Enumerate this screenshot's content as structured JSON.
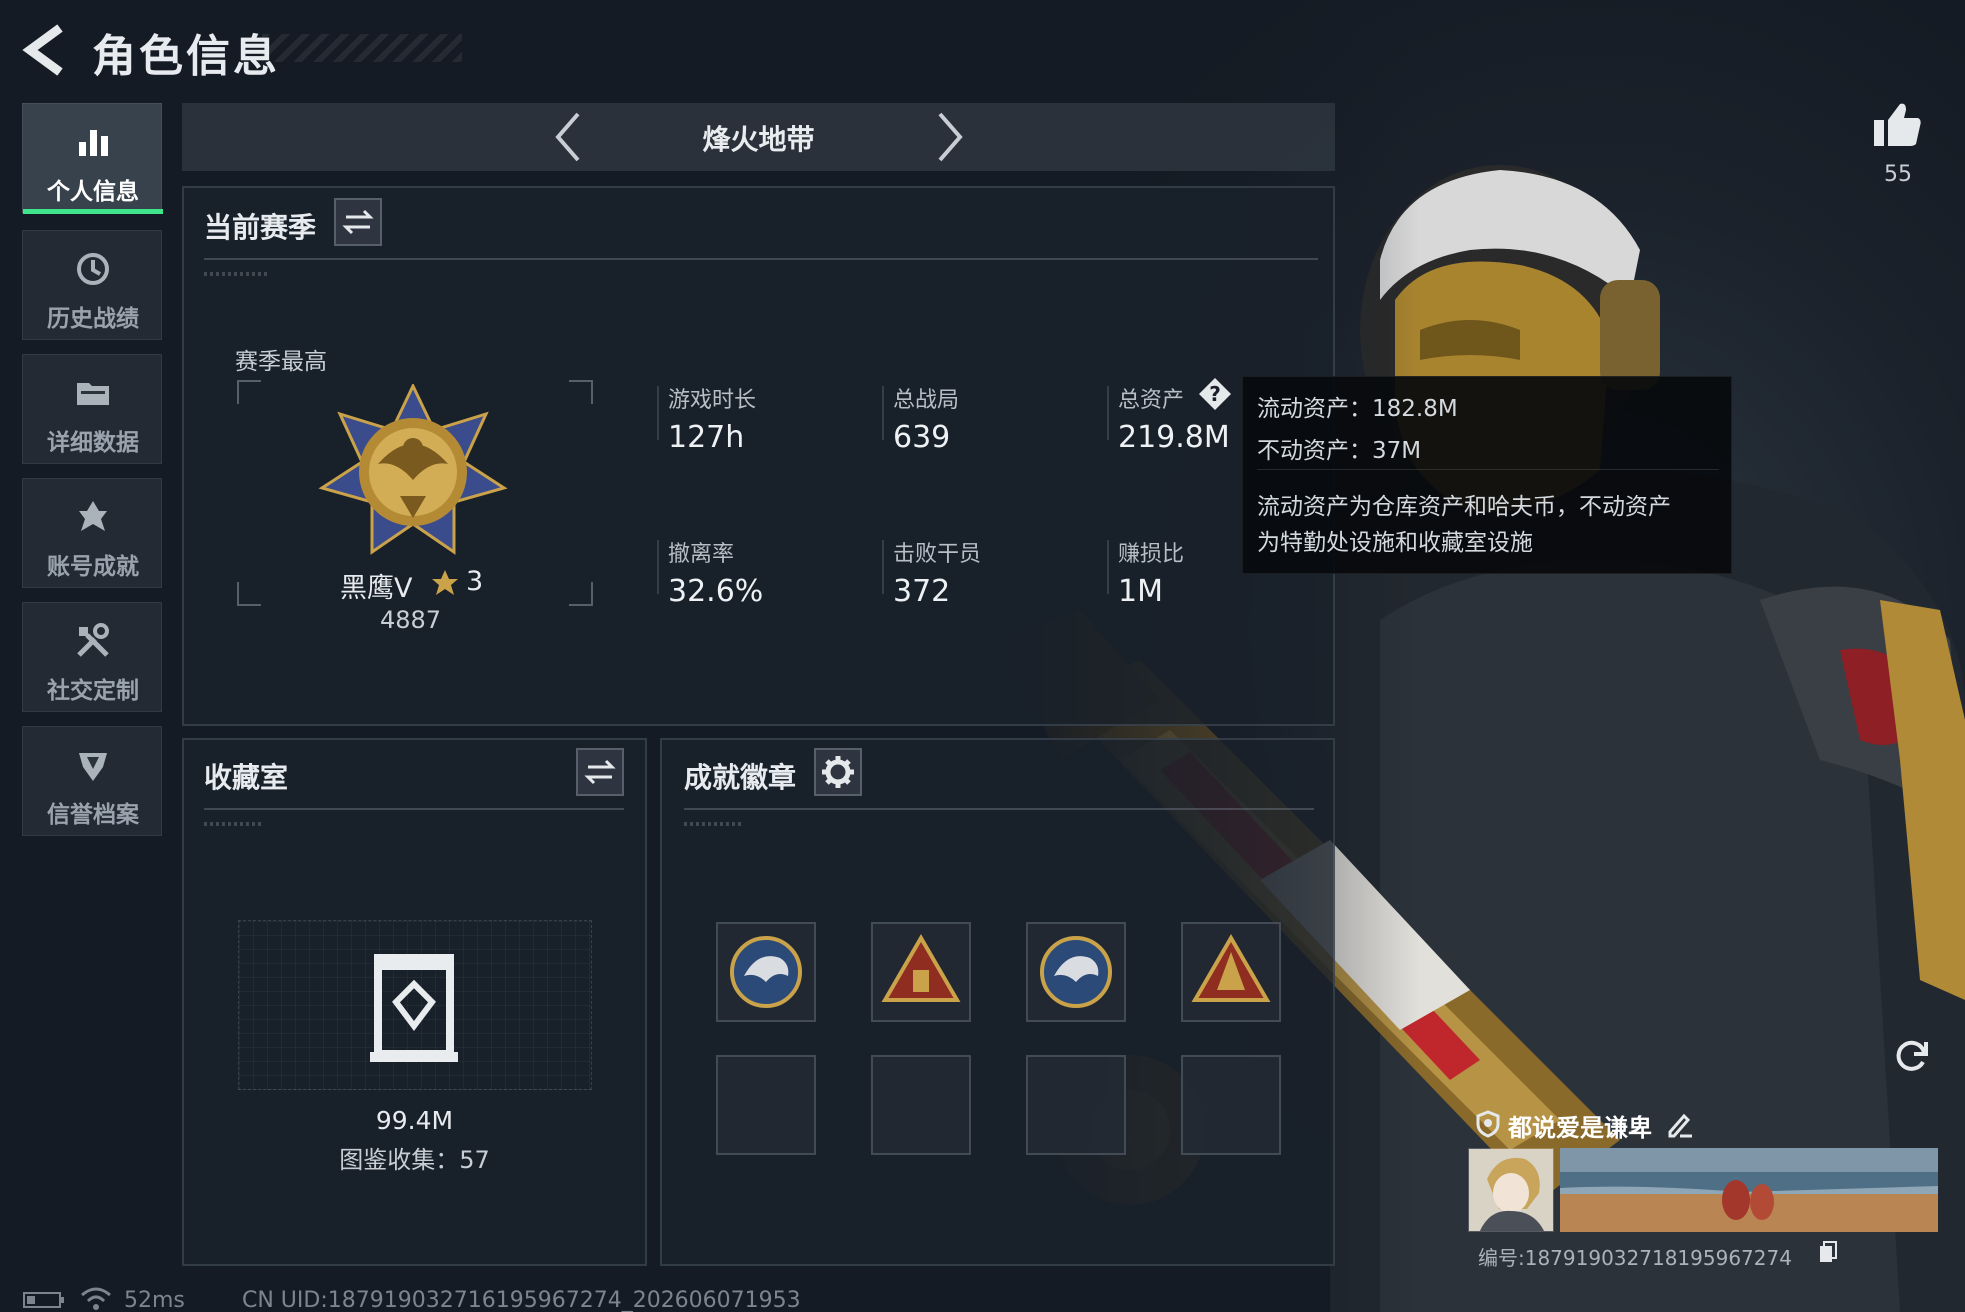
{
  "header": {
    "title": "角色信息"
  },
  "nav": [
    {
      "label": "个人信息",
      "icon": "bar-chart-icon",
      "active": true
    },
    {
      "label": "历史战绩",
      "icon": "history-clock-icon",
      "active": false
    },
    {
      "label": "详细数据",
      "icon": "folder-icon",
      "active": false
    },
    {
      "label": "账号成就",
      "icon": "achievement-star-icon",
      "active": false
    },
    {
      "label": "社交定制",
      "icon": "tools-icon",
      "active": false
    },
    {
      "label": "信誉档案",
      "icon": "credit-shield-icon",
      "active": false
    }
  ],
  "mode": {
    "label": "烽火地带"
  },
  "likes": {
    "count": "55"
  },
  "season": {
    "title": "当前赛季",
    "best_label": "赛季最高",
    "rank_name": "黑鹰V",
    "rank_stars": "3",
    "rank_points": "4887",
    "stats": [
      {
        "label": "游戏时长",
        "value": "127h"
      },
      {
        "label": "总战局",
        "value": "639"
      },
      {
        "label": "总资产",
        "value": "219.8M"
      },
      {
        "label": "撤离率",
        "value": "32.6%"
      },
      {
        "label": "击败干员",
        "value": "372"
      },
      {
        "label": "赚损比",
        "value": "1M"
      }
    ]
  },
  "tooltip": {
    "liquid": "流动资产：182.8M",
    "fixed": "不动资产：37M",
    "note_line1": "流动资产为仓库资产和哈夫币，不动资产",
    "note_line2": "为特勤处设施和收藏室设施"
  },
  "collection": {
    "title": "收藏室",
    "value": "99.4M",
    "catalog": "图鉴收集：57"
  },
  "badges": {
    "title": "成就徽章",
    "items": [
      "eagle-emblem-icon",
      "pyramid-emblem-icon",
      "eagle-emblem-icon",
      "pyramid-emblem-icon",
      "",
      "",
      "",
      ""
    ]
  },
  "namecard": {
    "name": "都说爱是谦卑",
    "id": "编号:18791903271819596727​4"
  },
  "footer": {
    "ping": "52ms",
    "uid": "CN UID:187919032716195967274_202606071953"
  },
  "colors": {
    "accent": "#3ee58b",
    "background": "#151b24",
    "gold": "#c9a24a"
  }
}
